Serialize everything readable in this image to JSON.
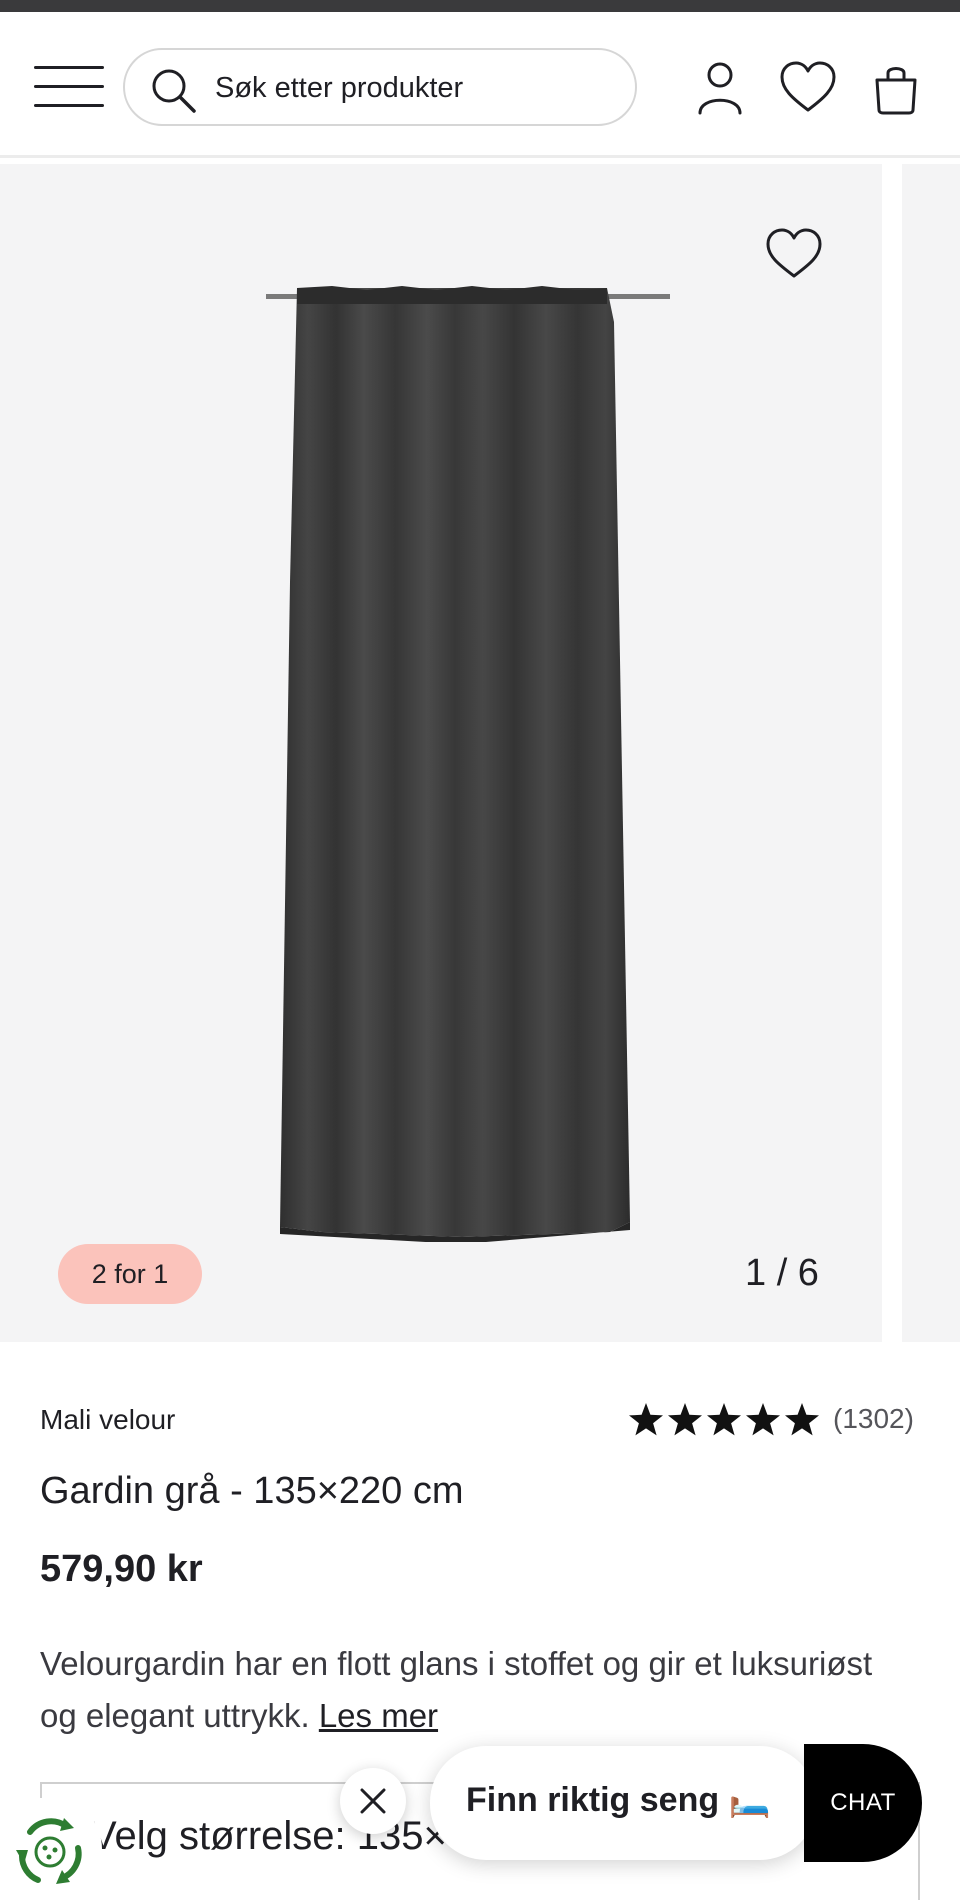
{
  "header": {
    "search_placeholder": "Søk etter produkter",
    "icons": [
      "menu-icon",
      "search-icon",
      "user-icon",
      "heart-icon",
      "shopping-bag-icon"
    ]
  },
  "gallery": {
    "badge": "2 for 1",
    "counter": "1 / 6",
    "current_image": 1,
    "total_images": 6
  },
  "product": {
    "brand": "Mali velour",
    "rating": 5,
    "review_count": "(1302)",
    "title": "Gardin grå - 135×220 cm",
    "price": "579,90 kr",
    "description": "Velourgardin har en flott glans i stoffet og gir et luksuriøst og elegant uttrykk.",
    "read_more": "Les mer",
    "size_selector": "Velg størrelse: 135×"
  },
  "overlay": {
    "promo_text": "Finn riktig seng 🛏️",
    "chat_label": "CHAT"
  },
  "colors": {
    "badge": "#fbc3bb",
    "chat": "#000000",
    "text": "#1f1f24",
    "curtain": "#3b3b3b",
    "eco_green": "#2e7d32"
  }
}
